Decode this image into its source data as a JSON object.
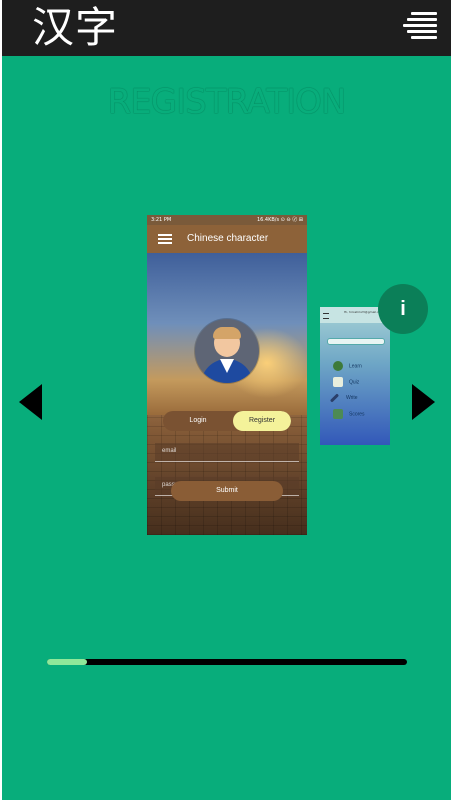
{
  "app": {
    "logo_text": "汉字",
    "menu_icon": "hamburger-menu-icon"
  },
  "page": {
    "heading": "REGISTRATION"
  },
  "carousel": {
    "slide_count": 4,
    "progress_fraction": 0.11,
    "main_slide": {
      "status_time": "3:21 PM",
      "status_right": "16.4KB/s ⊙ ⊖ 〄 ⊞",
      "app_title": "Chinese character",
      "toggle_login": "Login",
      "toggle_register": "Register",
      "email_placeholder": "email",
      "password_placeholder": "password",
      "submit_label": "Submit"
    },
    "second_slide": {
      "email": "Hi, hiroshi123@gmail.com",
      "items": [
        "Learn",
        "Quiz",
        "Write",
        "Scores"
      ]
    },
    "info_label": "i"
  },
  "colors": {
    "background": "#08ad7b",
    "topbar": "#1e1e1e",
    "progress_fill": "#8fe89a",
    "info_button": "#0b7f58"
  }
}
